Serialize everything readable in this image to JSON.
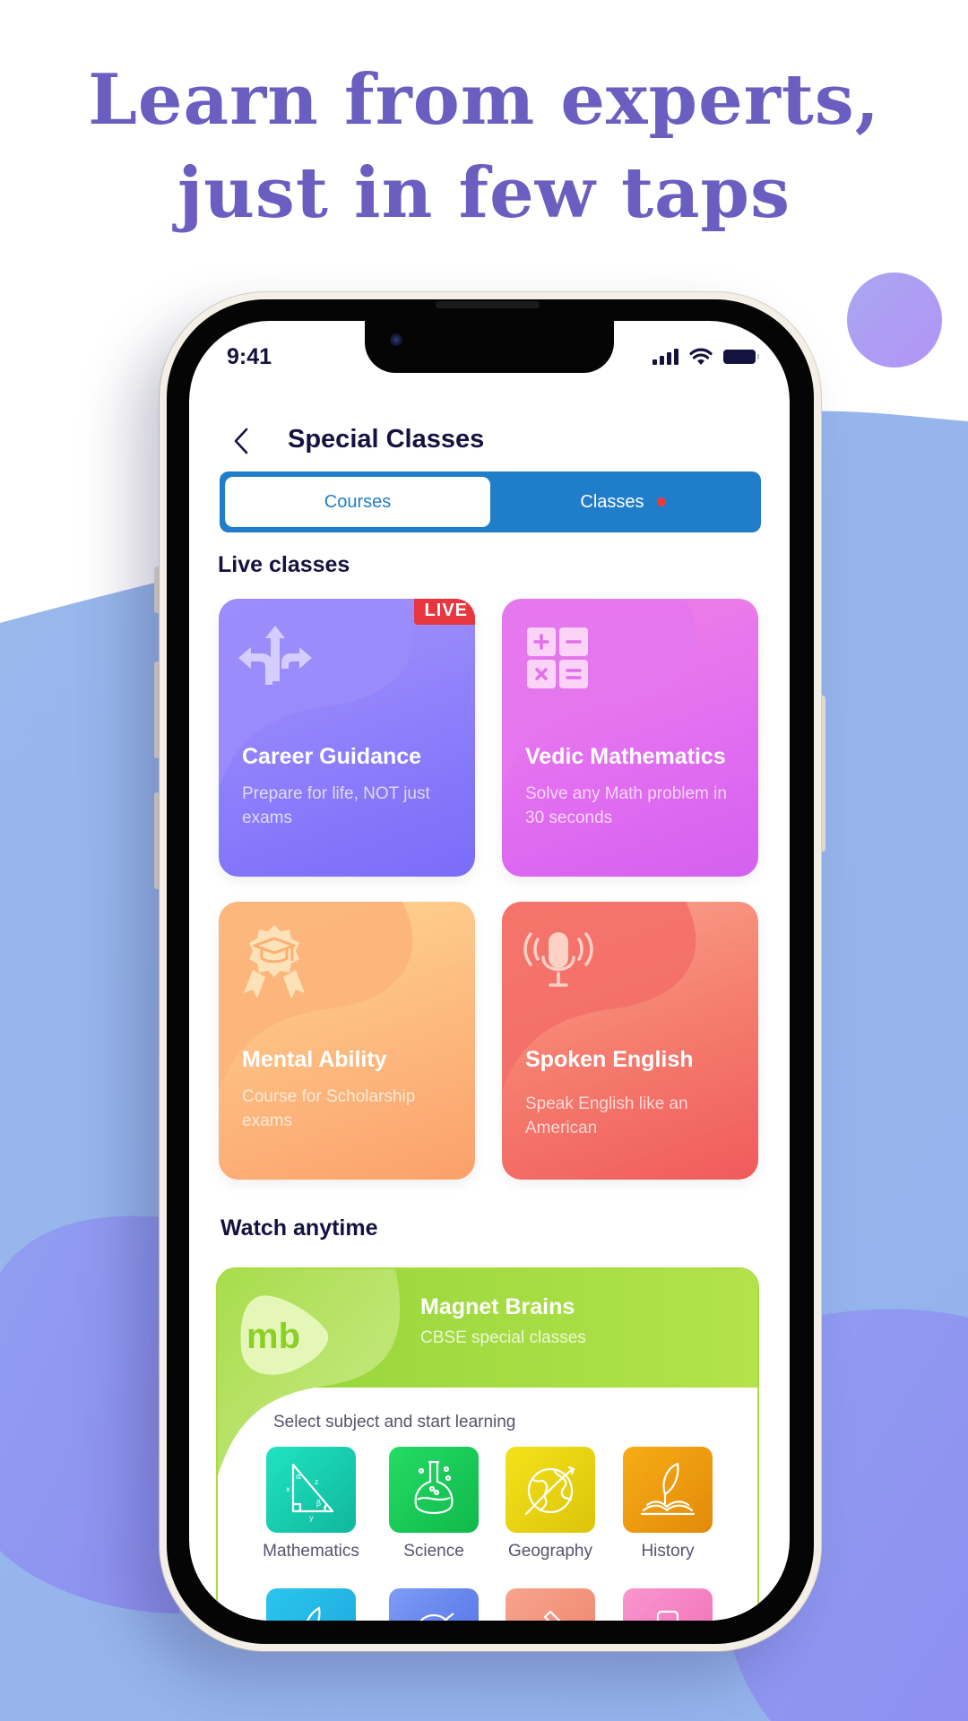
{
  "headline": {
    "line1": "Learn from experts,",
    "line2": "just in few taps"
  },
  "colors": {
    "headline": "#6a5fc1",
    "background_wave": "#97b6ec",
    "accent_blue": "#1f7dc9",
    "live_red": "#e8363f",
    "text_dark": "#14123f"
  },
  "status_bar": {
    "time": "9:41",
    "icons": [
      "signal-icon",
      "wifi-icon",
      "battery-icon"
    ]
  },
  "nav": {
    "back_icon": "chevron-left-icon",
    "title": "Special Classes"
  },
  "tabs": [
    {
      "label": "Courses",
      "active": true,
      "has_dot": false
    },
    {
      "label": "Classes",
      "active": false,
      "has_dot": true
    }
  ],
  "live_section": {
    "title": "Live classes",
    "cards": [
      {
        "title": "Career Guidance",
        "subtitle": "Prepare for life, NOT just exams",
        "icon": "direction-arrows-icon",
        "badge": "LIVE",
        "gradient": [
          "#8a7cfb",
          "#b69cf8"
        ]
      },
      {
        "title": "Vedic Mathematics",
        "subtitle": "Solve any Math problem in 30 seconds",
        "icon": "calculator-icon",
        "badge": null,
        "gradient": [
          "#d460f0",
          "#f482e2"
        ]
      },
      {
        "title": "Mental Ability",
        "subtitle": "Course for Scholarship exams",
        "icon": "award-ribbon-icon",
        "badge": null,
        "gradient": [
          "#fba06a",
          "#fdd594"
        ]
      },
      {
        "title": "Spoken English",
        "subtitle": "Speak English like an American",
        "icon": "microphone-icon",
        "badge": null,
        "gradient": [
          "#f05b5b",
          "#f8a18a"
        ]
      }
    ]
  },
  "watch_section": {
    "title": "Watch anytime",
    "provider": {
      "logo_text": "mb",
      "name": "Magnet Brains",
      "tagline": "CBSE special classes"
    },
    "prompt": "Select subject and start learning",
    "subjects": [
      {
        "label": "Mathematics",
        "icon": "triangle-geometry-icon",
        "gradient": [
          "#10b79c",
          "#20e3c2"
        ]
      },
      {
        "label": "Science",
        "icon": "flask-icon",
        "gradient": [
          "#0fb94a",
          "#25db66"
        ]
      },
      {
        "label": "Geography",
        "icon": "globe-icon",
        "gradient": [
          "#dcc40a",
          "#f4e21b"
        ]
      },
      {
        "label": "History",
        "icon": "quill-book-icon",
        "gradient": [
          "#e28a0a",
          "#f7ac14"
        ]
      },
      {
        "label": "",
        "icon": "quill-icon",
        "gradient": [
          "#1aa6d8",
          "#2cc5ef"
        ]
      },
      {
        "label": "",
        "icon": "globe-icon",
        "gradient": [
          "#4e6fe2",
          "#7e9bf6"
        ]
      },
      {
        "label": "",
        "icon": "gavel-icon",
        "gradient": [
          "#ee826a",
          "#f7a48e"
        ]
      },
      {
        "label": "",
        "icon": "chair-icon",
        "gradient": [
          "#f06cb7",
          "#f996cf"
        ]
      }
    ]
  }
}
